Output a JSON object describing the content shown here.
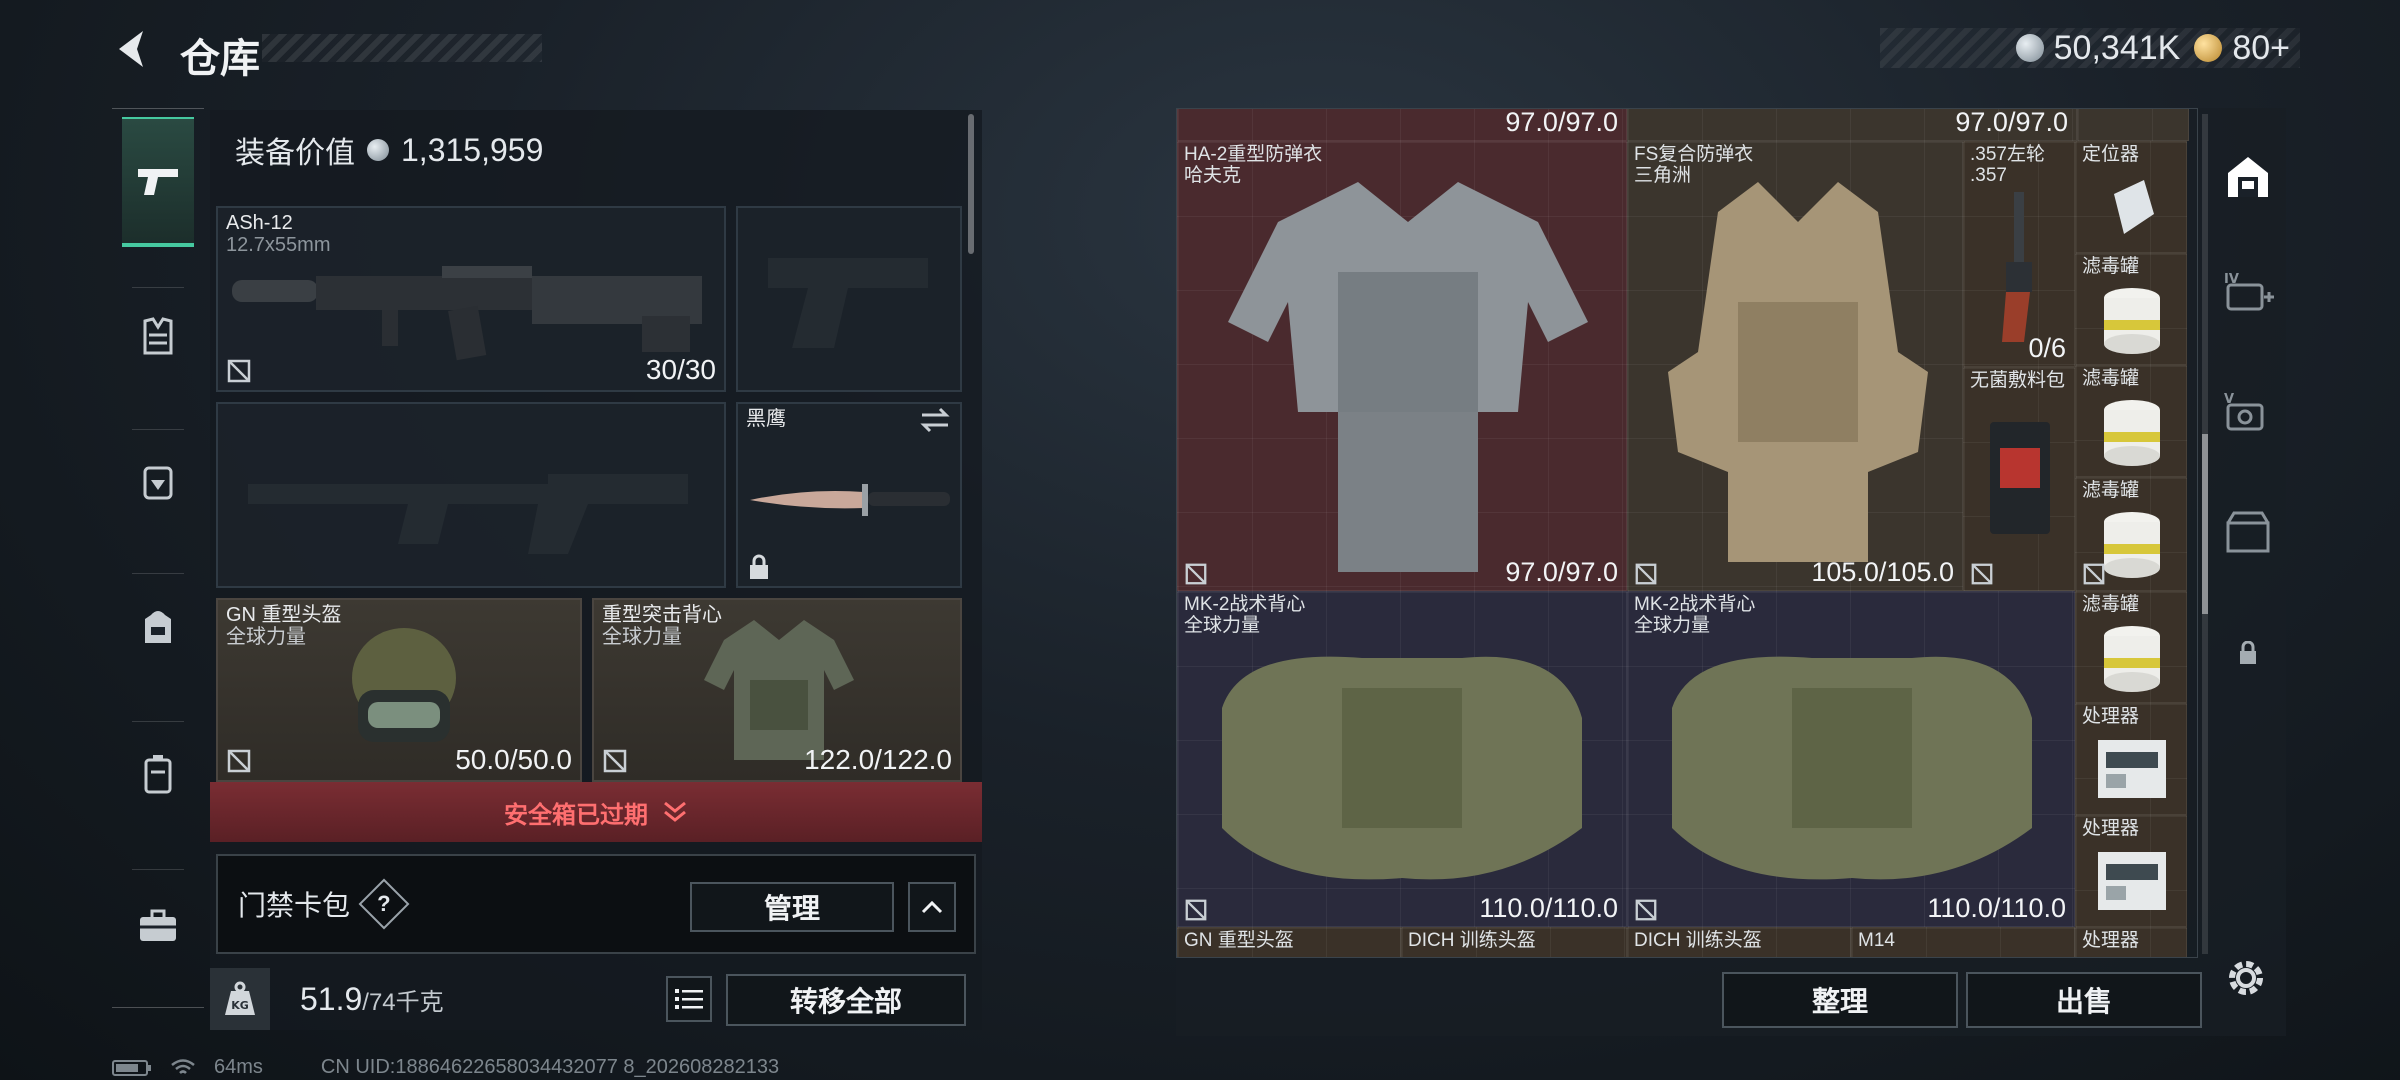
{
  "header": {
    "title": "仓库",
    "currency": [
      {
        "value": "50,341K",
        "coin": "silver"
      },
      {
        "value": "80+",
        "coin": "gold"
      }
    ]
  },
  "left": {
    "equip_value_label": "装备价值",
    "equip_value": "1,315,959",
    "slots": {
      "primary": {
        "name": "ASh-12",
        "sub": "12.7x55mm",
        "dura": "30/30"
      },
      "knife": {
        "name": "黑鹰"
      },
      "helmet": {
        "name": "GN 重型头盔",
        "sub": "全球力量",
        "dura": "50.0/50.0"
      },
      "vest": {
        "name": "重型突击背心",
        "sub": "全球力量",
        "dura": "122.0/122.0"
      }
    },
    "safe_banner": "安全箱已过期",
    "card_bag": {
      "label": "门禁卡包",
      "help": "?",
      "manage": "管理"
    },
    "weight": {
      "current": "51.9",
      "max": "/74千克"
    },
    "transfer_all": "转移全部"
  },
  "grid": {
    "top_partial": [
      "97.0/97.0",
      "97.0/97.0"
    ],
    "items": [
      {
        "name": "HA-2重型防弹衣",
        "sub": "哈夫克",
        "dura": "97.0/97.0"
      },
      {
        "name": "FS复合防弹衣",
        "sub": "三角洲",
        "dura": "105.0/105.0"
      },
      {
        "name": ".357左轮",
        "sub": ".357",
        "dura": "0/6"
      },
      {
        "name": "无菌敷料包"
      },
      {
        "name": "定位器"
      },
      {
        "name": "滤毒罐"
      },
      {
        "name": "滤毒罐"
      },
      {
        "name": "滤毒罐"
      },
      {
        "name": "滤毒罐"
      },
      {
        "name": "处理器"
      },
      {
        "name": "处理器"
      },
      {
        "name": "MK-2战术背心",
        "sub": "全球力量",
        "dura": "110.0/110.0"
      },
      {
        "name": "MK-2战术背心",
        "sub": "全球力量",
        "dura": "110.0/110.0"
      }
    ],
    "bottom_partial": [
      "GN 重型头盔",
      "DICH 训练头盔",
      "DICH 训练头盔",
      "M14",
      "处理器"
    ],
    "sort_button": "整理",
    "sell_button": "出售"
  },
  "status": {
    "ping": "64ms",
    "uid": "CN UID:18864622658034432077 8_202608282133"
  },
  "colors": {
    "accent": "#46c9a0",
    "alert": "#ff6f70"
  }
}
